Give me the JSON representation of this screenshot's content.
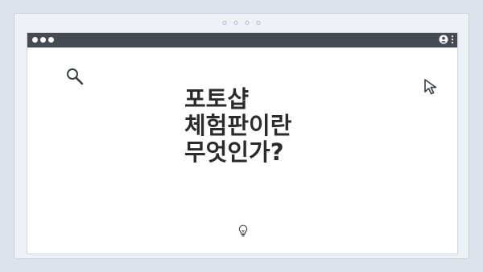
{
  "headline": {
    "lines": [
      "포토샵",
      "체험판이란",
      "무엇인가?"
    ]
  },
  "icons": {
    "search": "search-icon",
    "cursor": "cursor-arrow-icon",
    "bulb": "lightbulb-icon",
    "user": "user-icon",
    "menu": "kebab-menu-icon"
  },
  "colors": {
    "title_bar": "#454a53",
    "page_background": "#dde3ea",
    "window_background": "#ffffff",
    "headline_text": "#2b2b2b"
  }
}
